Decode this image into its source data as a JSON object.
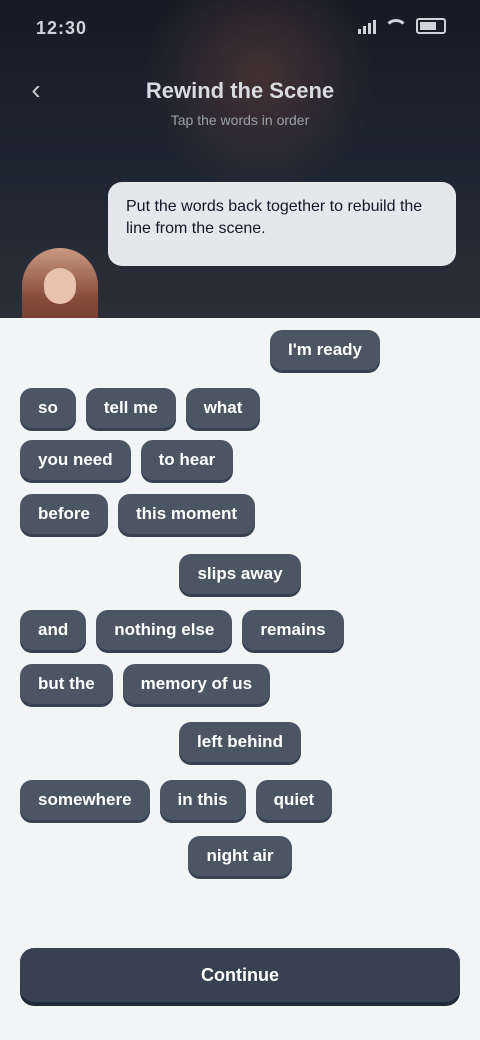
{
  "status": {
    "time": "12:30"
  },
  "header": {
    "title": "Rewind the Scene",
    "subtitle": "Tap the words in order"
  },
  "bubble": {
    "text": "Put the words back together to rebuild the line from the scene."
  },
  "sentence": {
    "rows": [
      {
        "align": "end",
        "words": [
          "I'm ready"
        ]
      },
      {
        "align": "start",
        "words": [
          "so",
          "tell me",
          "what"
        ]
      },
      {
        "align": "start",
        "words": [
          "you need",
          "to hear"
        ]
      },
      {
        "align": "start",
        "words": [
          "before",
          "this moment"
        ]
      },
      {
        "align": "center",
        "words": [
          "slips away"
        ]
      },
      {
        "align": "start",
        "words": [
          "and",
          "nothing else",
          "remains"
        ]
      },
      {
        "align": "start",
        "words": [
          "but the",
          "memory of us"
        ]
      },
      {
        "align": "center",
        "words": [
          "left behind"
        ]
      },
      {
        "align": "start",
        "words": [
          "somewhere",
          "in this",
          "quiet"
        ]
      },
      {
        "align": "center",
        "words": [
          "night air"
        ]
      }
    ]
  },
  "footer": {
    "continue_label": "Continue"
  }
}
